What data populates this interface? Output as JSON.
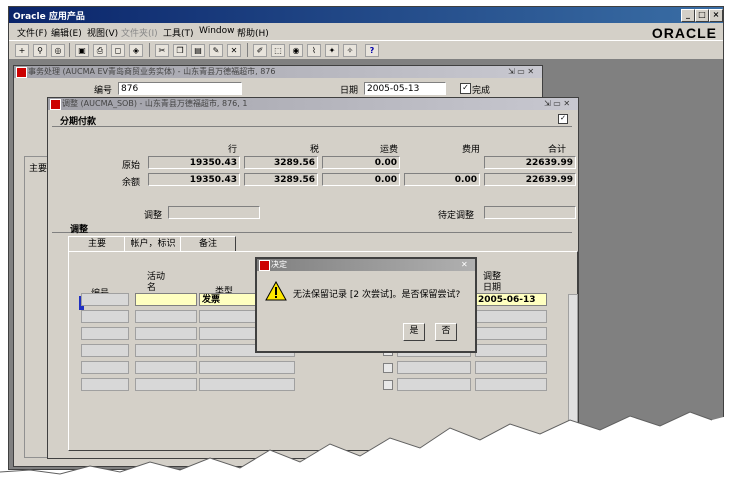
{
  "app": {
    "title": "Oracle 应用产品",
    "brand": "ORACLE",
    "menu": [
      "文件(F)",
      "编辑(E)",
      "视图(V)",
      "文件夹(I)",
      "工具(T)",
      "Window",
      "帮助(H)"
    ]
  },
  "window1": {
    "title": "事务处理 (AUCMA EV青岛商贸业务实体) - 山东青县万德福超市, 876",
    "number_label": "编号",
    "number_value": "876",
    "date_label": "日期",
    "date_value": "2005-05-13",
    "complete_label": "完成"
  },
  "bg_labels": {
    "main_tab": "主要"
  },
  "window2": {
    "title": "调整 (AUCMA_SOB) - 山东青县万德福超市, 876, 1",
    "section_title": "分期付款",
    "col_headers": [
      "行",
      "税",
      "运费",
      "费用",
      "合计"
    ],
    "rows": [
      {
        "label": "原始",
        "values": [
          "19350.43",
          "3289.56",
          "0.00",
          "",
          "22639.99"
        ]
      },
      {
        "label": "余额",
        "values": [
          "19350.43",
          "3289.56",
          "0.00",
          "0.00",
          "22639.99"
        ]
      }
    ],
    "adjust_label": "调整",
    "pending_label": "待定调整",
    "adjust_section": "调整",
    "tabs": [
      "主要",
      "帐户，标识",
      "备注"
    ],
    "grid": {
      "col_number": "编号",
      "col_activity": "活动\n名",
      "col_type": "类型",
      "col_adj_date": "调整\n日期",
      "first_type": "发票",
      "first_date": "2005-06-13"
    }
  },
  "dialog": {
    "title": "决定",
    "message": "无法保留记录 [2 次尝试]。是否保留尝试?",
    "yes": "是",
    "no": "否"
  },
  "colors": {
    "title_active": "#0a246a",
    "field_yellow": "#ffffc0",
    "panel": "#d4d0c8"
  }
}
